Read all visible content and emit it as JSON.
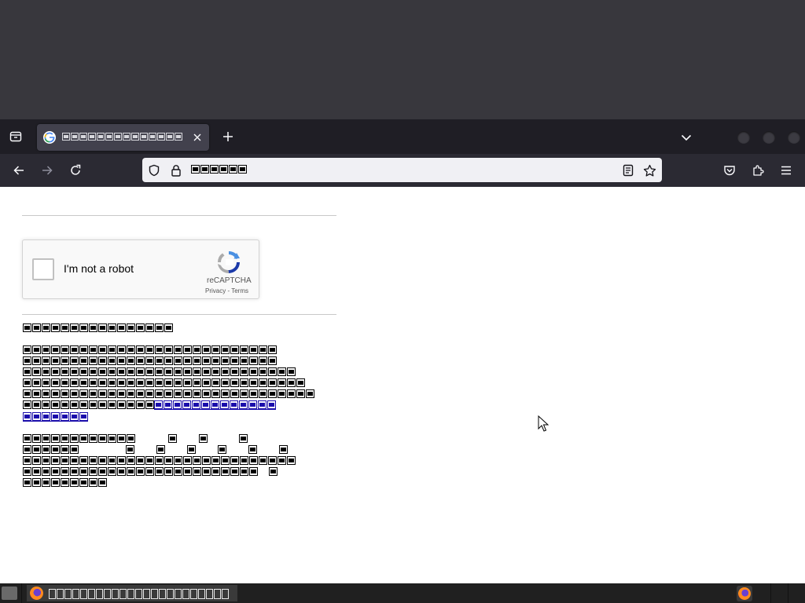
{
  "browser": {
    "tab": {
      "favicon": "google-g-icon"
    },
    "buttons": {
      "back": "arrow-left-icon",
      "forward": "arrow-right-icon",
      "reload": "reload-icon",
      "new_tab": "plus-icon",
      "tab_close": "close-icon",
      "tab_list": "chevron-down-icon",
      "pocket": "pocket-icon",
      "extensions": "puzzle-icon",
      "menu": "hamburger-icon",
      "reader": "reader-view-icon",
      "bookmark": "star-icon",
      "shield": "shield-icon",
      "lock": "lock-icon"
    }
  },
  "captcha": {
    "label": "I'm not a robot",
    "brand": "reCAPTCHA",
    "privacy": "Privacy",
    "separator": " - ",
    "terms": "Terms"
  },
  "colors": {
    "tab_bar": "#1f1e25",
    "nav_bar": "#2b2a33",
    "url_bar": "#f0f0f4",
    "page_bg": "#ffffff",
    "link": "#1a0dab",
    "taskbar": "#202020"
  }
}
